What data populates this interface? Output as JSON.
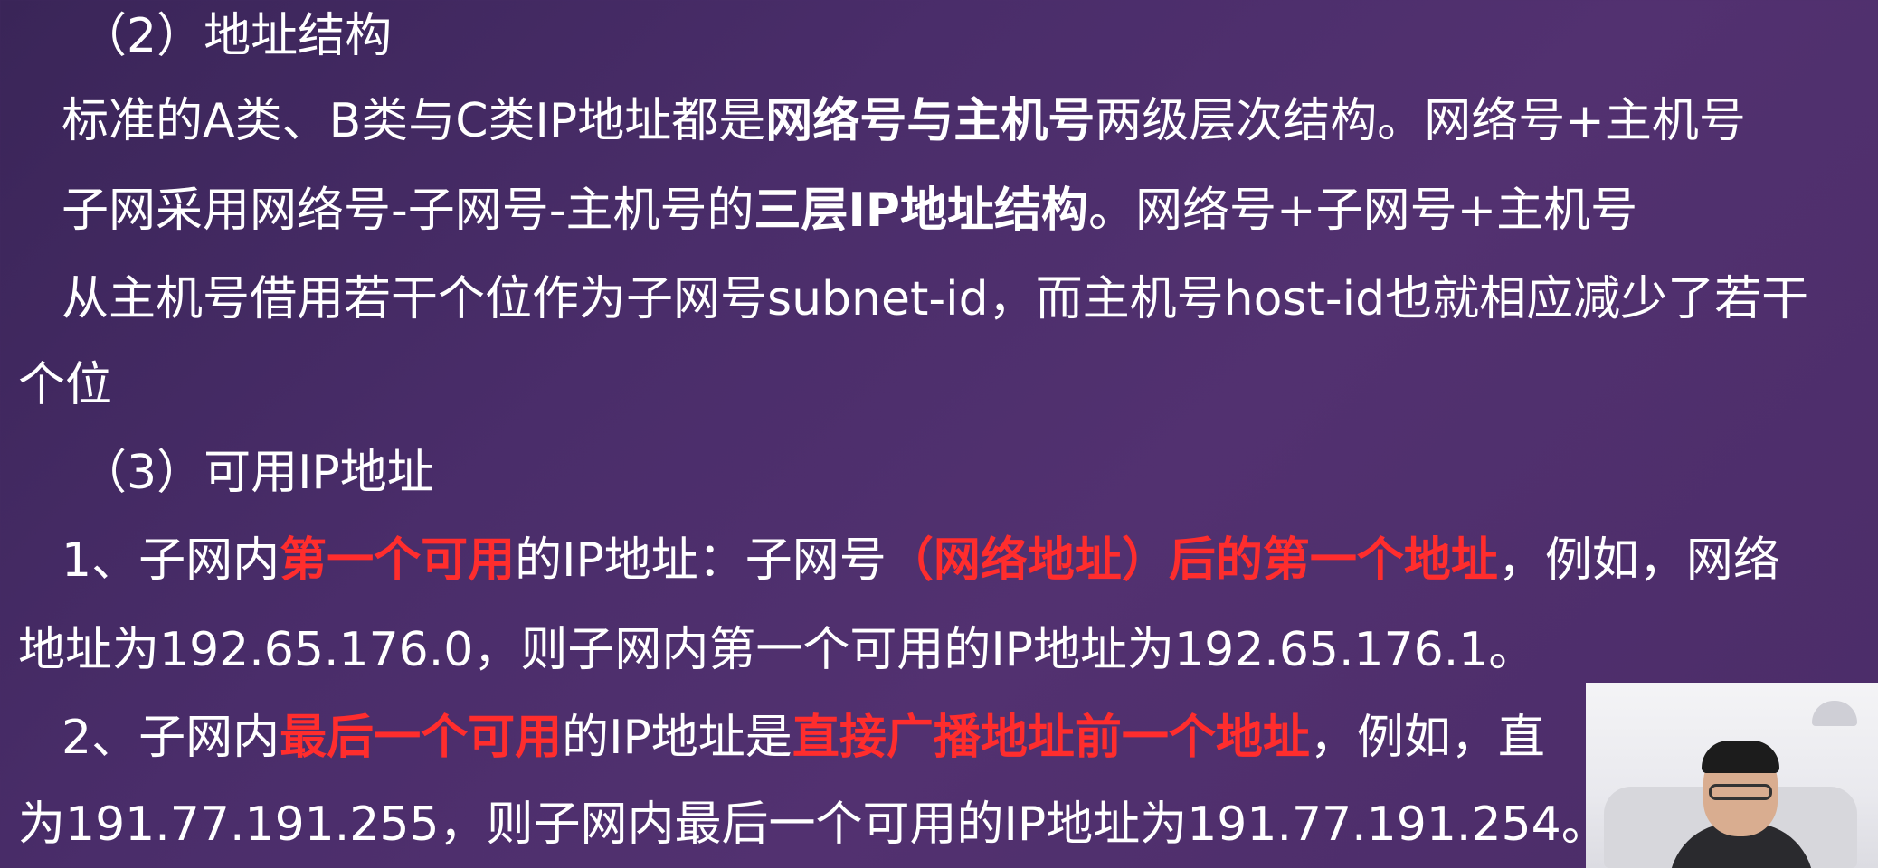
{
  "slide": {
    "heading_2": "（2）地址结构",
    "p1": {
      "t1": "标准的A类、B类与C类IP地址都是",
      "t2": "网络号与主机号",
      "t3": "两级层次结构。网络号+主机号"
    },
    "p2": {
      "t1": "子网采用网络号-子网号-主机号的",
      "t2": "三层IP地址结构",
      "t3": "。网络号+子网号+主机号"
    },
    "p3": {
      "line1": "从主机号借用若干个位作为子网号subnet-id，而主机号host-id也就相应减少了若干",
      "line2": "个位"
    },
    "heading_3": "（3）可用IP地址",
    "item1": {
      "t1": "1、子网内",
      "t2": "第一个可用",
      "t3": "的IP地址：子网号",
      "t4": "（网络地址）后的第一个地址",
      "t5": "，例如，网络",
      "line2": "地址为192.65.176.0，则子网内第一个可用的IP地址为192.65.176.1。"
    },
    "item2": {
      "t1": "2、子网内",
      "t2": "最后一个可用",
      "t3": "的IP地址是",
      "t4": "直接广播地址前一个地址",
      "t5": "，例如，直",
      "line2": "为191.77.191.255，则子网内最后一个可用的IP地址为191.77.191.254。"
    }
  },
  "colors": {
    "background": "#4a2d6a",
    "text": "#ffffff",
    "highlight": "#ff2d2d"
  }
}
